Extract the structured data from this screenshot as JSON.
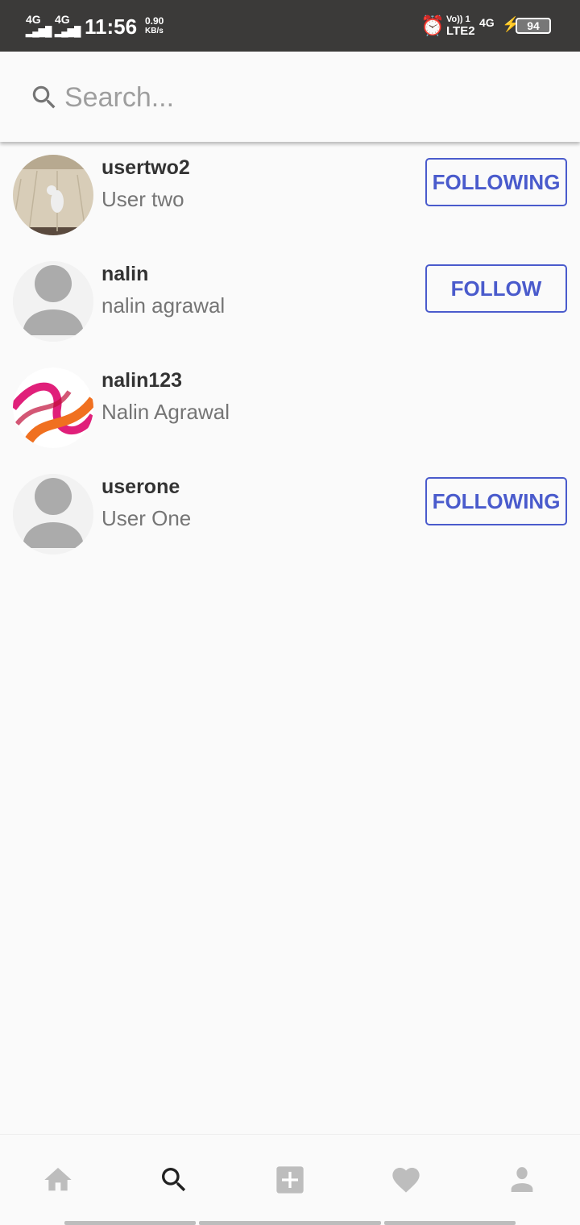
{
  "status_bar": {
    "net1": "4G",
    "net2": "4G",
    "time": "11:56",
    "speed": "0.90",
    "speed_unit": "KB/s",
    "volte": "Vo)) 1",
    "lte": "LTE2",
    "net3": "4G",
    "battery": "94"
  },
  "search": {
    "placeholder": "Search..."
  },
  "users": [
    {
      "username": "usertwo2",
      "name": "User two",
      "button": "FOLLOWING",
      "avatar": "photo-cat"
    },
    {
      "username": "nalin",
      "name": "nalin agrawal",
      "button": "FOLLOW",
      "avatar": "default-person"
    },
    {
      "username": "nalin123",
      "name": "Nalin Agrawal",
      "button": null,
      "avatar": "photo-smoke"
    },
    {
      "username": "userone",
      "name": "User One",
      "button": "FOLLOWING",
      "avatar": "default-person"
    }
  ],
  "nav": [
    "home-icon",
    "search-icon",
    "add-icon",
    "heart-icon",
    "profile-icon"
  ],
  "colors": {
    "accent": "#4a5bcc",
    "status_bar": "#3b3a39",
    "icon_inactive": "#bdbdbd",
    "icon_active": "#212121"
  }
}
